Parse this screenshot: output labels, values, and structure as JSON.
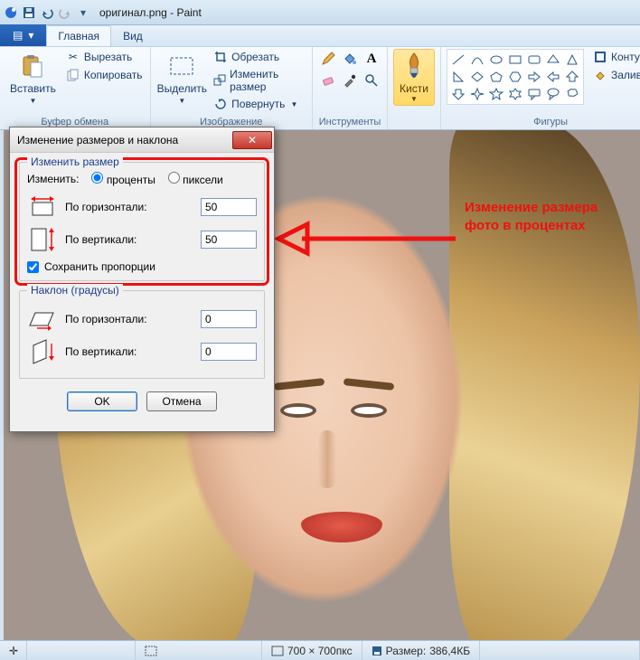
{
  "window": {
    "title": "оригинал.png - Paint"
  },
  "tabs": {
    "file": "",
    "main": "Главная",
    "view": "Вид"
  },
  "ribbon": {
    "clipboard": {
      "paste": "Вставить",
      "cut": "Вырезать",
      "copy": "Копировать",
      "label": "Буфер обмена"
    },
    "image": {
      "select": "Выделить",
      "crop": "Обрезать",
      "resize": "Изменить размер",
      "rotate": "Повернуть",
      "label": "Изображение"
    },
    "tools": {
      "label": "Инструменты"
    },
    "brushes": {
      "label": "Кисти"
    },
    "shapes": {
      "outline": "Контур",
      "fill": "Заливка",
      "label": "Фигуры"
    }
  },
  "dialog": {
    "title": "Изменение размеров и наклона",
    "resize": {
      "legend": "Изменить размер",
      "by_label": "Изменить:",
      "percent": "проценты",
      "pixels": "пиксели",
      "horizontal": "По горизонтали:",
      "vertical": "По вертикали:",
      "h_value": "50",
      "v_value": "50",
      "aspect": "Сохранить пропорции"
    },
    "skew": {
      "legend": "Наклон (градусы)",
      "horizontal": "По горизонтали:",
      "vertical": "По вертикали:",
      "h_value": "0",
      "v_value": "0"
    },
    "ok": "OK",
    "cancel": "Отмена"
  },
  "annotation": {
    "text": "Изменение размера фото в процентах"
  },
  "status": {
    "dimensions": "700 × 700пкс",
    "size_label": "Размер:",
    "size_value": "386,4КБ"
  }
}
